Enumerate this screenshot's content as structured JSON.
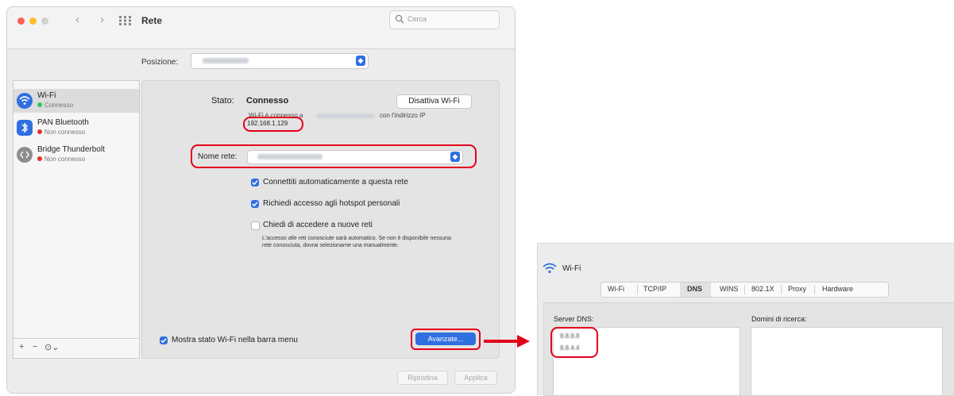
{
  "main_window": {
    "title": "Rete",
    "search_placeholder": "Cerca",
    "location_label": "Posizione:",
    "services": [
      {
        "name": "Wi-Fi",
        "status": "Connesso",
        "status_color": "#34c759",
        "icon": "wifi-icon"
      },
      {
        "name": "PAN Bluetooth",
        "status": "Non connesso",
        "status_color": "#e5312d",
        "icon": "bluetooth-icon"
      },
      {
        "name": "Bridge Thunderbolt",
        "status": "Non connesso",
        "status_color": "#e5312d",
        "icon": "thunderbolt-bridge-icon"
      }
    ],
    "sidebar_footer": {
      "add": "+",
      "remove": "−",
      "actions": "⊙⌄"
    },
    "status_label": "Stato:",
    "status_value": "Connesso",
    "turn_off_wifi": "Disattiva Wi-Fi",
    "connected_desc_prefix": "Wi-Fi è connesso a",
    "connected_desc_suffix": "con l'indirizzo IP",
    "ip_address": "192.168.1.129",
    "network_name_label": "Nome rete:",
    "options": [
      {
        "label": "Connettiti automaticamente a questa rete",
        "checked": true
      },
      {
        "label": "Richiedi accesso agli hotspot personali",
        "checked": true
      },
      {
        "label": "Chiedi di accedere a nuove reti",
        "checked": false
      }
    ],
    "note": "L'accesso alle reti conosciute sarà automatico. Se non è disponibile nessuna rete conosciuta, dovrai selezionarne una manualmente.",
    "show_status_label": "Mostra stato Wi-Fi nella barra menu",
    "advanced_button": "Avanzate...",
    "revert_button": "Ripristina",
    "apply_button": "Applica"
  },
  "advanced_window": {
    "title": "Wi-Fi",
    "tabs": [
      "Wi-Fi",
      "TCP/IP",
      "DNS",
      "WINS",
      "802.1X",
      "Proxy",
      "Hardware"
    ],
    "active_tab": "DNS",
    "dns_servers_label": "Server DNS:",
    "search_domains_label": "Domini di ricerca:",
    "dns_servers": [
      "8.8.8.8",
      "8.8.4.4"
    ]
  },
  "colors": {
    "highlight_red": "#e3001b",
    "accent_blue": "#2f6fe0"
  }
}
